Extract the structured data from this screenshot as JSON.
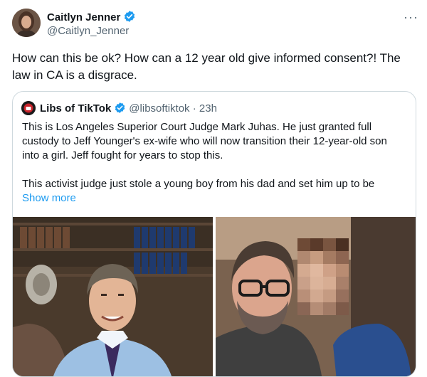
{
  "author": {
    "name": "Caitlyn Jenner",
    "handle": "@Caitlyn_Jenner"
  },
  "more_label": "···",
  "tweet_text": "How can this be ok? How can a 12 year old give informed consent?! The law in CA is a disgrace.",
  "quoted": {
    "name": "Libs of TikTok",
    "handle": "@libsoftiktok",
    "separator": " · ",
    "time": "23h",
    "paragraph1": "This is Los Angeles Superior Court Judge Mark Juhas. He just granted full custody to Jeff Younger's ex-wife who will now transition their 12-year-old son into a girl. Jeff fought for years to stop this.",
    "paragraph2": "This activist judge just stole a young boy from his dad and set him up to be",
    "show_more": "Show more"
  },
  "colors": {
    "verified_badge": "#1d9bf0",
    "link": "#1d9bf0",
    "secondary_text": "#536471"
  }
}
